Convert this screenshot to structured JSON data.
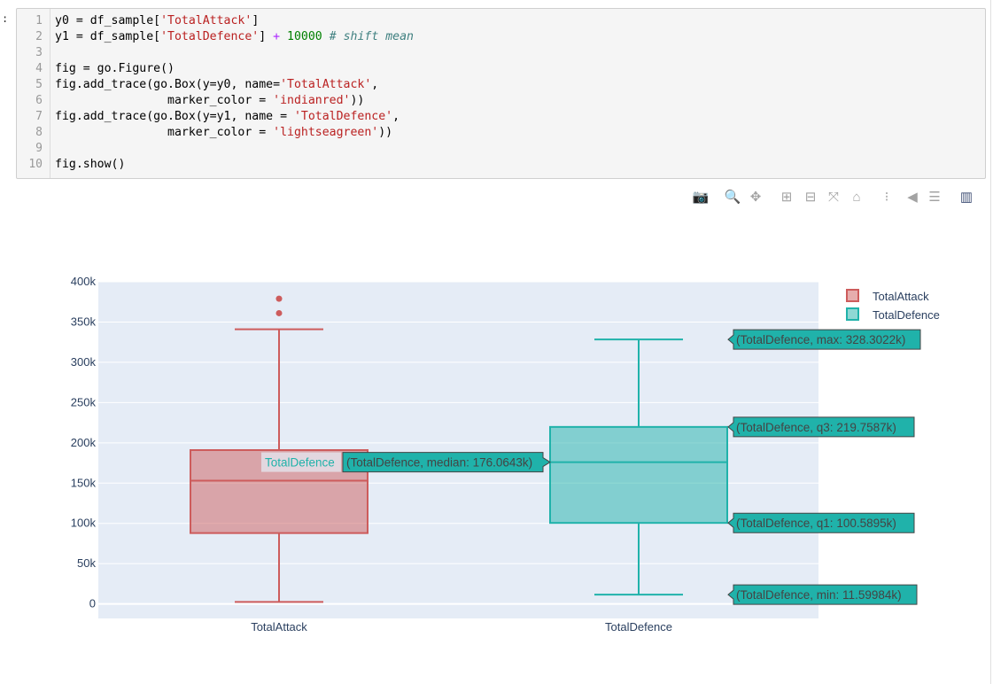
{
  "notebook": {
    "prompt": ":",
    "code_lines": [
      {
        "n": "1",
        "parts": [
          {
            "t": "y0 = df_sample[",
            "c": ""
          },
          {
            "t": "'TotalAttack'",
            "c": "tk-str"
          },
          {
            "t": "]",
            "c": ""
          }
        ]
      },
      {
        "n": "2",
        "parts": [
          {
            "t": "y1 = df_sample[",
            "c": ""
          },
          {
            "t": "'TotalDefence'",
            "c": "tk-str"
          },
          {
            "t": "] ",
            "c": ""
          },
          {
            "t": "+",
            "c": "tk-op"
          },
          {
            "t": " ",
            "c": ""
          },
          {
            "t": "10000",
            "c": "tk-num"
          },
          {
            "t": " ",
            "c": ""
          },
          {
            "t": "# shift mean",
            "c": "tk-com"
          }
        ]
      },
      {
        "n": "3",
        "parts": []
      },
      {
        "n": "4",
        "parts": [
          {
            "t": "fig = go.Figure()",
            "c": ""
          }
        ]
      },
      {
        "n": "5",
        "parts": [
          {
            "t": "fig.add_trace(go.Box(y=y0, name=",
            "c": ""
          },
          {
            "t": "'TotalAttack'",
            "c": "tk-str"
          },
          {
            "t": ",",
            "c": ""
          }
        ]
      },
      {
        "n": "6",
        "parts": [
          {
            "t": "                marker_color = ",
            "c": ""
          },
          {
            "t": "'indianred'",
            "c": "tk-str"
          },
          {
            "t": "))",
            "c": ""
          }
        ]
      },
      {
        "n": "7",
        "parts": [
          {
            "t": "fig.add_trace(go.Box(y=y1, name = ",
            "c": ""
          },
          {
            "t": "'TotalDefence'",
            "c": "tk-str"
          },
          {
            "t": ",",
            "c": ""
          }
        ]
      },
      {
        "n": "8",
        "parts": [
          {
            "t": "                marker_color = ",
            "c": ""
          },
          {
            "t": "'lightseagreen'",
            "c": "tk-str"
          },
          {
            "t": "))",
            "c": ""
          }
        ]
      },
      {
        "n": "9",
        "parts": []
      },
      {
        "n": "10",
        "parts": [
          {
            "t": "fig.show()",
            "c": ""
          }
        ]
      }
    ]
  },
  "modebar": [
    {
      "icon": "camera-icon",
      "glyph": "📷",
      "name": "modebar-download-png"
    },
    {
      "icon": "zoom-icon",
      "glyph": "🔍",
      "name": "modebar-zoom"
    },
    {
      "icon": "pan-icon",
      "glyph": "✥",
      "name": "modebar-pan"
    },
    {
      "icon": "zoom-in-icon",
      "glyph": "⊞",
      "name": "modebar-zoom-in"
    },
    {
      "icon": "zoom-out-icon",
      "glyph": "⊟",
      "name": "modebar-zoom-out"
    },
    {
      "icon": "autoscale-icon",
      "glyph": "⤧",
      "name": "modebar-autoscale"
    },
    {
      "icon": "home-icon",
      "glyph": "⌂",
      "name": "modebar-reset-axes"
    },
    {
      "icon": "spike-lines-icon",
      "glyph": "⁝",
      "name": "modebar-toggle-spikelines"
    },
    {
      "icon": "hover-closest-icon",
      "glyph": "◀",
      "name": "modebar-hover-closest"
    },
    {
      "icon": "hover-compare-icon",
      "glyph": "☰",
      "name": "modebar-hover-compare"
    },
    {
      "icon": "plotly-logo-icon",
      "glyph": "▥",
      "name": "modebar-plotly-logo"
    }
  ],
  "colors": {
    "attack": "#cd5c5c",
    "attack_fill": "rgba(205,92,92,0.5)",
    "defence": "#20b2aa",
    "defence_fill": "rgba(32,178,170,0.5)",
    "plot_bg": "#e5ecf6",
    "tooltip_bg": "#20b2aa",
    "tooltip_border": "#444444",
    "axis_text": "#2a3f5f"
  },
  "chart_data": {
    "type": "box",
    "categories": [
      "TotalAttack",
      "TotalDefence"
    ],
    "y_ticks": [
      0,
      50000,
      100000,
      150000,
      200000,
      250000,
      300000,
      350000,
      400000
    ],
    "y_tick_labels": [
      "0",
      "50k",
      "100k",
      "150k",
      "200k",
      "250k",
      "300k",
      "350k",
      "400k"
    ],
    "ylim": [
      -18000,
      400000
    ],
    "legend_placement": "top-right",
    "series": [
      {
        "name": "TotalAttack",
        "min": 2500,
        "q1": 88000,
        "median": 153000,
        "q3": 191000,
        "max": 341000,
        "outliers": [
          361000,
          379000
        ]
      },
      {
        "name": "TotalDefence",
        "min": 11599.84,
        "q1": 100589.5,
        "median": 176064.3,
        "q3": 219758.7,
        "max": 328302.2,
        "outliers": []
      }
    ],
    "hover": {
      "label": "TotalDefence",
      "tooltips": [
        {
          "key": "max",
          "text": "(TotalDefence, max: 328.3022k)"
        },
        {
          "key": "q3",
          "text": "(TotalDefence, q3: 219.7587k)"
        },
        {
          "key": "median",
          "text": "(TotalDefence, median: 176.0643k)"
        },
        {
          "key": "q1",
          "text": "(TotalDefence, q1: 100.5895k)"
        },
        {
          "key": "min",
          "text": "(TotalDefence, min: 11.59984k)"
        }
      ]
    }
  }
}
